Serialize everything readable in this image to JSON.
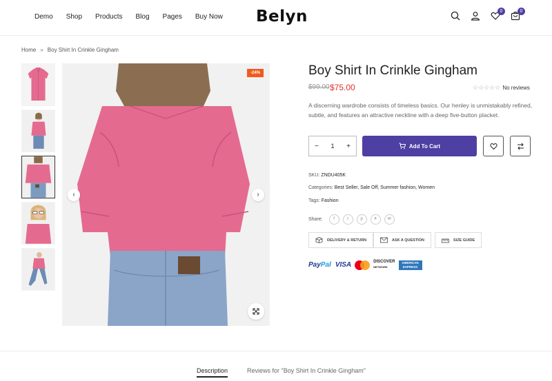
{
  "header": {
    "nav": [
      "Demo",
      "Shop",
      "Products",
      "Blog",
      "Pages",
      "Buy Now"
    ],
    "logo": "Belyn",
    "wishlist_count": "0",
    "cart_count": "0"
  },
  "breadcrumb": {
    "home": "Home",
    "separator": "»",
    "current": "Boy Shirt In Crinkle Gingham"
  },
  "gallery": {
    "sale_badge": "-24%",
    "prev_icon": "chevron-left-icon",
    "next_icon": "chevron-right-icon",
    "zoom_icon": "expand-icon"
  },
  "product": {
    "title": "Boy Shirt In Crinkle Gingham",
    "old_price": "$99.00",
    "price": "$75.00",
    "stars": "☆☆☆☆☆",
    "reviews_text": "No reviews",
    "description": "A discerning wardrobe consists of timeless basics. Our henley is unmistakably refined, subtle, and features an attractive neckline with a deep five-button placket.",
    "qty_minus": "−",
    "qty_value": "1",
    "qty_plus": "+",
    "add_to_cart": "Add To Cart",
    "sku_label": "SKU:",
    "sku": "ZNDU405K",
    "categories_label": "Categories:",
    "categories": "Best Seller, Sale Off, Summer fashion, Women",
    "tags_label": "Tags:",
    "tags": "Fashion",
    "share_label": "Share:",
    "social": [
      "f",
      "t",
      "p",
      "✈",
      "✉"
    ],
    "delivery": "DELIVERY & RETURN",
    "ask": "ASK A QUESTION",
    "size_guide": "SIZE GUIDE"
  },
  "payments": {
    "paypal_a": "Pay",
    "paypal_b": "Pal",
    "visa": "VISA",
    "discover": "DISCOVER",
    "discover_sub": "NETWORK",
    "amex_a": "AMERICAN",
    "amex_b": "EXPRESS"
  },
  "tabs": {
    "description": "Description",
    "reviews": "Reviews for \"Boy Shirt In Crinkle Gingham\""
  },
  "colors": {
    "accent": "#4e3fa3",
    "sale": "#f25a1d",
    "price": "#e4312b",
    "shirt": "#e46b8f"
  }
}
